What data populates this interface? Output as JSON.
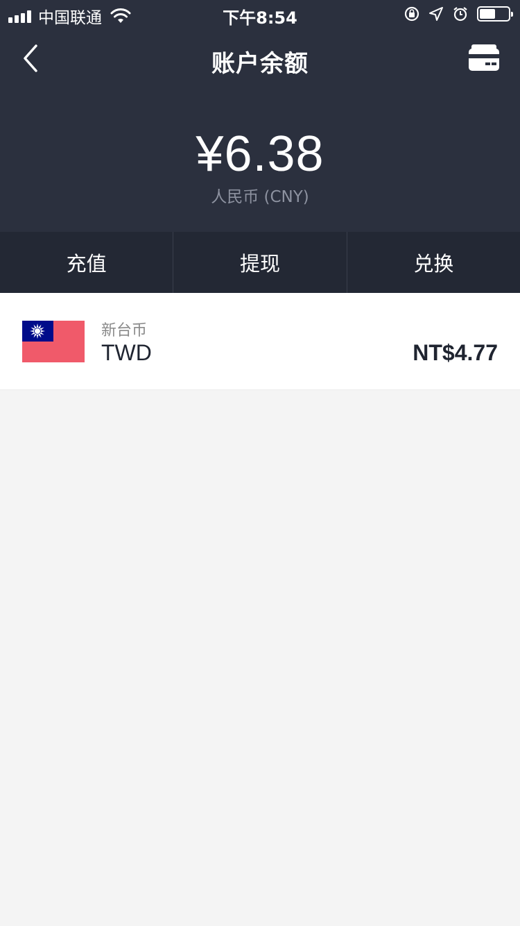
{
  "status_bar": {
    "carrier": "中国联通",
    "time": "下午8:54",
    "battery_level": 0.55,
    "icons": [
      "signal-icon",
      "wifi-icon",
      "rotation-lock-icon",
      "location-icon",
      "alarm-icon",
      "battery-icon"
    ]
  },
  "nav": {
    "title": "账户余额",
    "back_icon": "chevron-left-icon",
    "right_icon": "card-icon"
  },
  "balance": {
    "amount": "¥6.38",
    "currency": "人民币 (CNY)"
  },
  "actions": [
    {
      "label": "充值"
    },
    {
      "label": "提现"
    },
    {
      "label": "兑换"
    }
  ],
  "currencies": [
    {
      "name": "新台币",
      "code": "TWD",
      "amount": "NT$4.77",
      "flag": "taiwan-flag"
    }
  ],
  "colors": {
    "header_bg": "#2b303e",
    "action_bar_bg": "#232834",
    "page_bg": "#f4f4f4"
  }
}
